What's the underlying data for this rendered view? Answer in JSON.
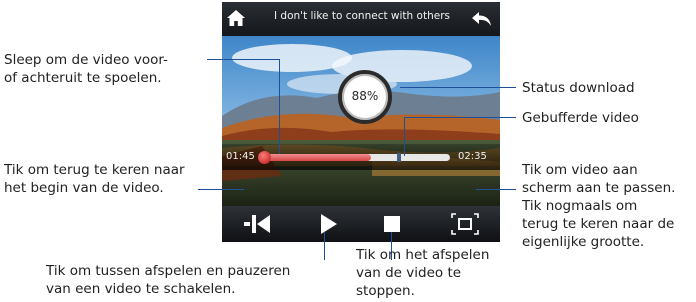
{
  "screen": {
    "title": "I don't like to connect with others",
    "download_status": "88%",
    "time_elapsed": "01:45",
    "time_total": "02:35",
    "playback_progress": 0.58,
    "buffered_progress": 0.72
  },
  "annotations": {
    "seek_line1": "Sleep om de video voor-",
    "seek_line2": "of achteruit te spoelen.",
    "status_download": "Status download",
    "buffered_video": "Gebufferde video",
    "restart_line1": "Tik om terug te keren naar",
    "restart_line2": "het begin van de video.",
    "playpause_line1": "Tik om tussen afspelen en pauzeren",
    "playpause_line2": "van een video te schakelen.",
    "stop_line1": "Tik om het afspelen",
    "stop_line2": "van de video te",
    "stop_line3": "stoppen.",
    "fit_line1": "Tik om video aan",
    "fit_line2": "scherm aan te passen.",
    "fit_line3": "Tik nogmaals om",
    "fit_line4": "terug te keren naar de",
    "fit_line5": "eigenlijke grootte."
  },
  "icons": {
    "home": "home-icon",
    "back": "back-arrow-icon",
    "restart": "skip-to-start-icon",
    "play": "play-icon",
    "stop": "stop-icon",
    "fit": "fit-to-screen-icon"
  },
  "colors": {
    "progress_fill": "#d84747",
    "callout_line": "#1d4f9a"
  }
}
